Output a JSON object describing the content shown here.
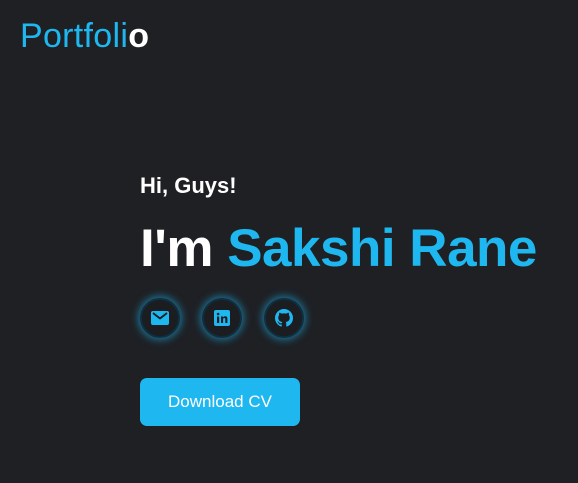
{
  "header": {
    "logo_main": "Portfoli",
    "logo_tail": "o"
  },
  "hero": {
    "greeting": "Hi, Guys!",
    "headline_prefix": "I'm",
    "headline_name": "Sakshi Rane",
    "download_label": "Download CV"
  },
  "socials": [
    {
      "icon": "mail-icon"
    },
    {
      "icon": "linkedin-icon"
    },
    {
      "icon": "github-icon"
    }
  ],
  "colors": {
    "background": "#1e2024",
    "accent": "#1fb7f0",
    "text": "#ffffff"
  }
}
